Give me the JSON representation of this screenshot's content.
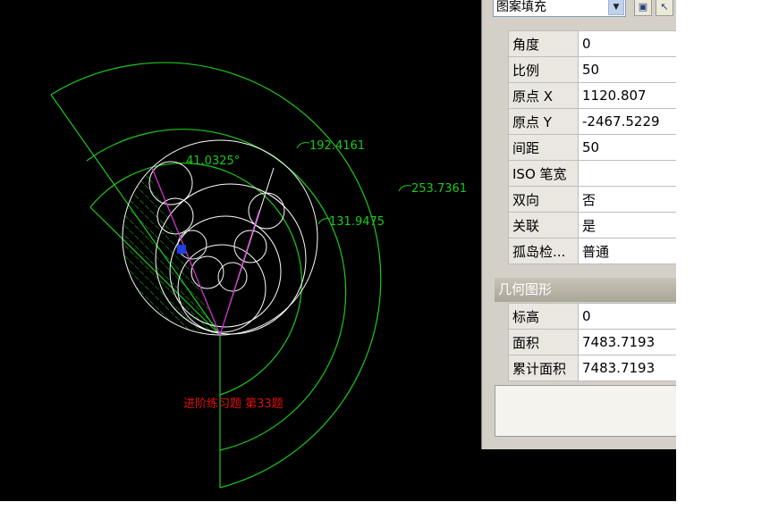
{
  "drawing": {
    "dimensions": {
      "angle": "41.0325°",
      "arc_inner": "192.4161",
      "arc_outer": "253.7361",
      "arc_mid": "131.9475"
    },
    "caption": "进阶练习题 第33题"
  },
  "properties": {
    "object_type": "图案填充",
    "rows": [
      {
        "key": "角度",
        "value": "0"
      },
      {
        "key": "比例",
        "value": "50"
      },
      {
        "key": "原点 X",
        "value": "1120.807"
      },
      {
        "key": "原点 Y",
        "value": "-2467.5229"
      },
      {
        "key": "间距",
        "value": "50"
      },
      {
        "key": "ISO 笔宽",
        "value": ""
      },
      {
        "key": "双向",
        "value": "否"
      },
      {
        "key": "关联",
        "value": "是"
      },
      {
        "key": "孤岛检...",
        "value": "普通"
      }
    ],
    "geometry_header": "几何图形",
    "geometry_rows": [
      {
        "key": "标高",
        "value": "0"
      },
      {
        "key": "面积",
        "value": "7483.7193"
      },
      {
        "key": "累计面积",
        "value": "7483.7193"
      }
    ]
  },
  "colors": {
    "canvas_bg": "#000000",
    "dimension_line": "#1ec81e",
    "geometry": "#ffffff",
    "center_line": "#c828c8",
    "grip": "#1f3fe0",
    "caption": "#e01010"
  }
}
